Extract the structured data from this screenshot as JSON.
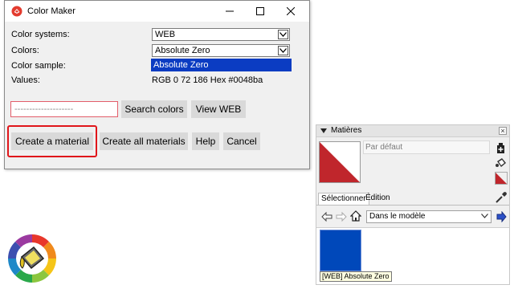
{
  "dialog": {
    "title": "Color Maker",
    "labels": {
      "color_systems": "Color systems:",
      "colors": "Colors:",
      "color_sample": "Color sample:",
      "values": "Values:"
    },
    "color_system_value": "WEB",
    "color_value": "Absolute Zero",
    "color_list_selected": "Absolute Zero",
    "values_text": "RGB 0 72 186 Hex #0048ba",
    "search_placeholder": "--------------------",
    "buttons": {
      "search": "Search colors",
      "view": "View  WEB",
      "create_material": "Create a material",
      "create_all": "Create all materials",
      "help": "Help",
      "cancel": "Cancel"
    }
  },
  "materials_panel": {
    "title": "Matières",
    "material_name": "Par défaut",
    "tabs": [
      "Sélectionner",
      "Édition"
    ],
    "collection": "Dans le modèle",
    "swatch_tooltip": "[WEB] Absolute Zero"
  },
  "colors": {
    "sample": "#0048ba",
    "highlight": "#e0161b",
    "selection": "#0b3cc2",
    "default_material": "#c0262c"
  },
  "icons": [
    "app-logo-icon",
    "minimize-icon",
    "maximize-icon",
    "close-icon",
    "chevron-down-icon",
    "back-arrow-icon",
    "forward-arrow-icon",
    "home-icon",
    "eyedropper-icon",
    "paint-bucket-logo"
  ]
}
